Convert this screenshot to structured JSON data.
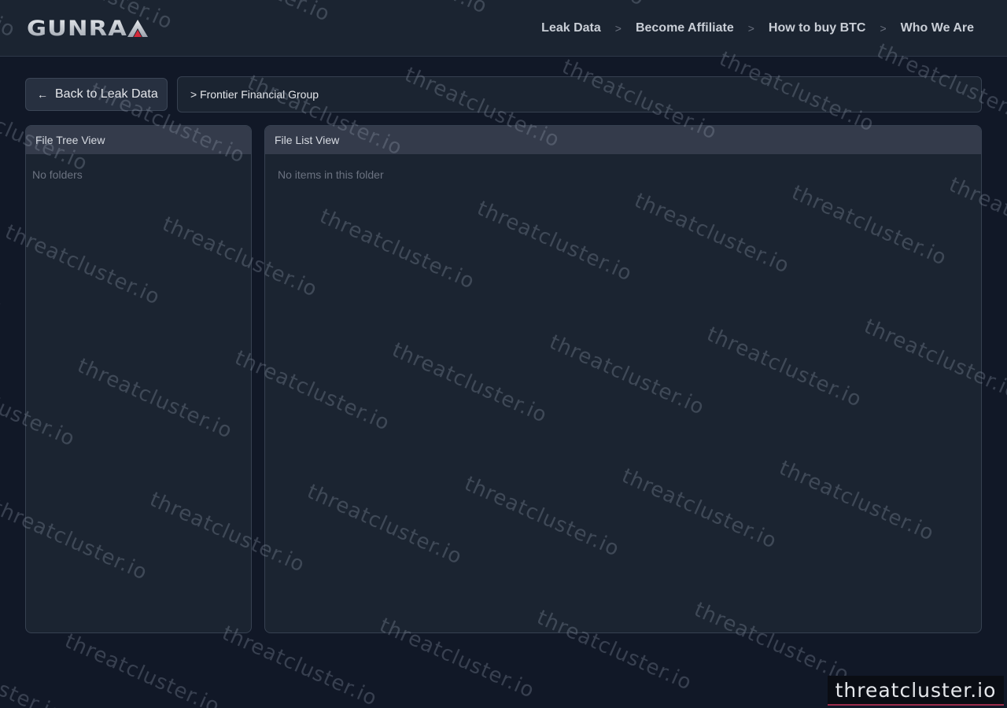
{
  "header": {
    "logo_text": "GUNRA",
    "nav": [
      {
        "label": "Leak Data"
      },
      {
        "label": "Become Affiliate"
      },
      {
        "label": "How to buy BTC"
      },
      {
        "label": "Who We Are"
      }
    ],
    "nav_separator": ">"
  },
  "toolbar": {
    "back_arrow": "←",
    "back_label": "Back to Leak Data",
    "path": "> Frontier Financial Group"
  },
  "tree_panel": {
    "title": "File Tree View",
    "empty_text": "No folders"
  },
  "list_panel": {
    "title": "File List View",
    "empty_text": "No items in this folder"
  },
  "watermark": {
    "text": "threatcluster.io"
  },
  "colors": {
    "background": "#111827",
    "header": "#1b2431",
    "panel": "#1b2431",
    "panel_header": "#343b4b",
    "logo_accent": "#d42a3a",
    "badge_underline": "#9b2c4a"
  }
}
